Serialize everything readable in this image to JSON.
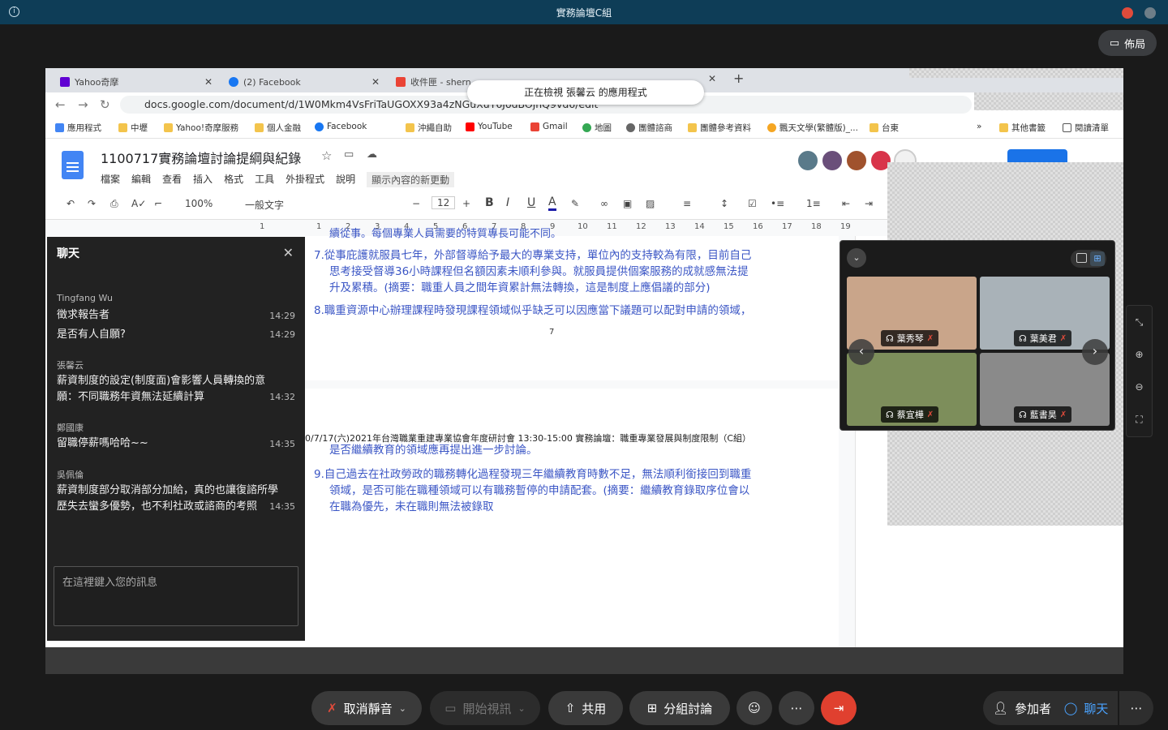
{
  "window": {
    "title": "實務論壇C組"
  },
  "layout_button": {
    "label": "佈局"
  },
  "browser": {
    "tabs": [
      {
        "label": "Yahoo奇摩",
        "color": "#6001d2"
      },
      {
        "label": "(2) Facebook",
        "color": "#1877f2"
      },
      {
        "label": "收件匣 - shern",
        "color": "#ea4335"
      }
    ],
    "url": "docs.google.com/document/d/1W0Mkm4VsFriTaUGOXX93a4zNGuXuT6JodBOjhQ9vd6/edit",
    "viewing_banner": "正在檢視 張馨云 的應用程式",
    "bookmarks": [
      "應用程式",
      "中壢",
      "Yahoo!奇摩服務",
      "個人金融",
      "Facebook",
      "沖繩自助",
      "YouTube",
      "Gmail",
      "地圖",
      "團體諮商",
      "團體參考資料",
      "飄天文學(繁體版)_...",
      "台東",
      "»",
      "其他書籤",
      "閱讀清單"
    ]
  },
  "doc": {
    "title": "1100717實務論壇討論提綱與紀錄",
    "menu": [
      "檔案",
      "編輯",
      "查看",
      "插入",
      "格式",
      "工具",
      "外掛程式",
      "說明"
    ],
    "update_notice": "顯示內容的新更動",
    "toolbar": {
      "zoom": "100%",
      "style": "一般文字",
      "font_size": "12",
      "bold": "B",
      "italic": "I",
      "underline": "U",
      "text_color": "A"
    },
    "ruler": [
      "1",
      "1",
      "2",
      "3",
      "4",
      "5",
      "6",
      "7",
      "8",
      "9",
      "10",
      "11",
      "12",
      "13",
      "14",
      "15",
      "16",
      "17",
      "18",
      "19"
    ],
    "page1_top": "續從事。每個專業人員需要的特質專長可能不同。",
    "para7": [
      "7.從事庇護就服員七年，外部督導給予最大的專業支持，單位內的支持較為有限，目前自己",
      "思考接受督導36小時課程但名額因素未順利參與。就服員提供個案服務的成就感無法提",
      "升及累積。(摘要：職重人員之間年資累計無法轉換，這是制度上應倡議的部分)"
    ],
    "para8": "8.職重資源中心辦理課程時發現課程領域似乎缺乏可以因應當下議題可以配對申請的領域，",
    "page_number": "7",
    "page2_header": "0/7/17(六)2021年台灣職業重建專業協會年度研討會 13:30-15:00 實務論壇：職重專業發展與制度限制（C組）",
    "para8_cont": "是否繼續教育的領域應再提出進一步討論。",
    "para9": [
      "9.自己過去在社政勞政的職務轉化過程發現三年繼續教育時數不足，無法順利銜接回到職重",
      "領域，是否可能在職種領域可以有職務暫停的申請配套。(摘要：繼續教育錄取序位會以",
      "在職為優先，未在職則無法被錄取"
    ]
  },
  "chat": {
    "title": "聊天",
    "messages": [
      {
        "sender": "Tingfang Wu",
        "lines": [
          {
            "text": "徵求報告者",
            "time": "14:29"
          },
          {
            "text": "是否有人自願?",
            "time": "14:29"
          }
        ]
      },
      {
        "sender": "張馨云",
        "lines": [
          {
            "text": "薪資制度的設定(制度面)會影響人員轉換的意",
            "time": ""
          },
          {
            "text": "願：不同職務年資無法延續計算",
            "time": "14:32"
          }
        ]
      },
      {
        "sender": "鄭國康",
        "lines": [
          {
            "text": "留職停薪嗎哈哈~~",
            "time": "14:35"
          }
        ]
      },
      {
        "sender": "吳佩倫",
        "lines": [
          {
            "text": "薪資制度部分取消部分加給，真的也讓復諮所學",
            "time": ""
          },
          {
            "text": "歷失去蠻多優勢，也不利社政或諮商的考照",
            "time": "14:35"
          }
        ]
      }
    ],
    "input_placeholder": "在這裡鍵入您的訊息"
  },
  "gallery": {
    "participants": [
      {
        "name": "葉秀琴",
        "bg": "#c9a58a"
      },
      {
        "name": "葉美君",
        "bg": "#a9b2b8"
      },
      {
        "name": "蔡宜樺",
        "bg": "#7d8e5b"
      },
      {
        "name": "藍書昊",
        "bg": "#8a8a8a"
      }
    ]
  },
  "bottom": {
    "mute": "取消靜音",
    "video": "開始視訊",
    "share": "共用",
    "breakout": "分組討論",
    "participants": "參加者",
    "chat": "聊天"
  }
}
